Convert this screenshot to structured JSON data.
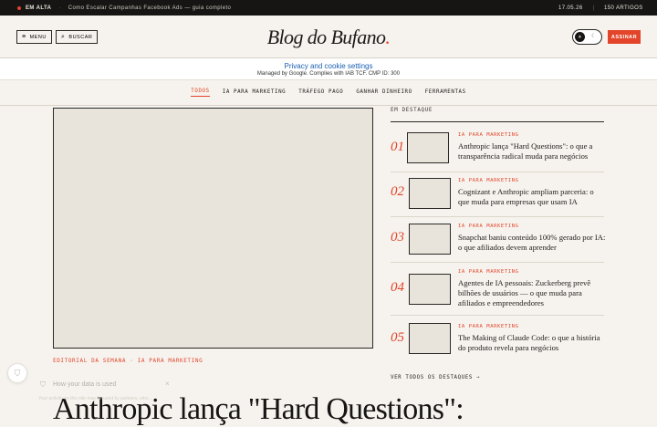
{
  "topbar": {
    "em_alta": "EM ALTA",
    "separator": "·",
    "trending": "Como Escalar Campanhas Facebook Ads — guia completo",
    "date": "17.05.26",
    "divider": "|",
    "articles": "150 ARTIGOS"
  },
  "header": {
    "menu_label": "MENU",
    "search_label": "BUSCAR",
    "logo": "Blog do Bufano",
    "logo_dot": ".",
    "subscribe_label": "ASSINAR"
  },
  "privacy": {
    "title": "Privacy and cookie settings",
    "subtitle": "Managed by Google. Complies with IAB TCF. CMP ID: 300"
  },
  "nav": {
    "items": [
      "TODOS",
      "IA PARA MARKETING",
      "TRÁFEGO PAGO",
      "GANHAR DINHEIRO",
      "FERRAMENTAS"
    ]
  },
  "hero": {
    "kicker": "EDITORIAL DA SEMANA · IA PARA MARKETING",
    "title": "Anthropic lança \"Hard Questions\":"
  },
  "featured": {
    "label": "EM DESTAQUE",
    "items": [
      {
        "num": "01",
        "kicker": "IA PARA MARKETING",
        "title": "Anthropic lança \"Hard Questions\": o que a transparência radical muda para negócios"
      },
      {
        "num": "02",
        "kicker": "IA PARA MARKETING",
        "title": "Cognizant e Anthropic ampliam parceria: o que muda para empresas que usam IA"
      },
      {
        "num": "03",
        "kicker": "IA PARA MARKETING",
        "title": "Snapchat baniu conteúdo 100% gerado por IA: o que afiliados devem aprender"
      },
      {
        "num": "04",
        "kicker": "IA PARA MARKETING",
        "title": "Agentes de IA pessoais: Zuckerberg prevê bilhões de usuários — o que muda para afiliados e empreendedores"
      },
      {
        "num": "05",
        "kicker": "IA PARA MARKETING",
        "title": "The Making of Claude Code: o que a história do produto revela para negócios"
      }
    ],
    "view_all": "VER TODOS OS DESTAQUES →"
  },
  "cookie_popup": {
    "title": "How your data is used",
    "body": "Your activity on this site may be used by partners, who..."
  },
  "colors": {
    "accent": "#e2452a",
    "background": "#f6f3ee",
    "dark": "#161514"
  },
  "icons": {
    "menu": "menu-icon",
    "search": "search-icon",
    "theme": "theme-toggle-icon",
    "shield": "shield-icon",
    "close": "close-icon"
  }
}
